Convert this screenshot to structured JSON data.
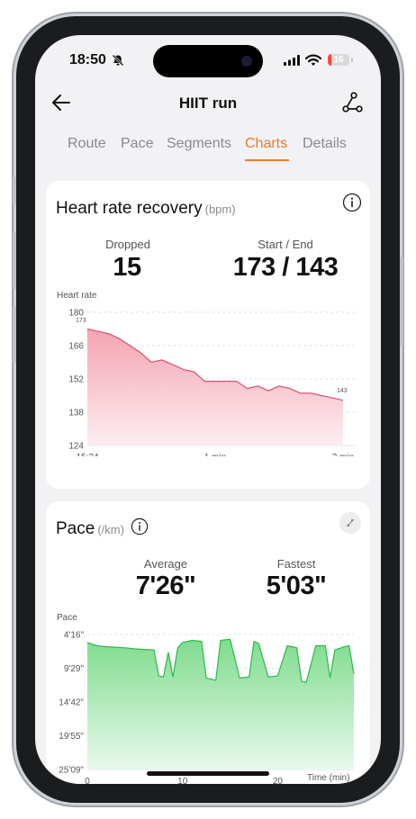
{
  "status_bar": {
    "time": "18:50",
    "battery_level": "16"
  },
  "nav": {
    "title": "HIIT run"
  },
  "tabs": [
    {
      "label": "Route",
      "active": false
    },
    {
      "label": "Pace",
      "active": false
    },
    {
      "label": "Segments",
      "active": false
    },
    {
      "label": "Charts",
      "active": true
    },
    {
      "label": "Details",
      "active": false
    }
  ],
  "heart_rate": {
    "title": "Heart rate recovery",
    "unit": "(bpm)",
    "dropped_label": "Dropped",
    "dropped_value": "15",
    "start_end_label": "Start / End",
    "start_end_value": "173 / 143",
    "y_axis_title": "Heart rate",
    "start_marker": "173",
    "end_marker": "143"
  },
  "pace": {
    "title": "Pace",
    "unit": "(/km)",
    "average_label": "Average",
    "average_value": "7'26\"",
    "fastest_label": "Fastest",
    "fastest_value": "5'03\"",
    "y_axis_title": "Pace",
    "x_axis_title": "Time (min)"
  },
  "colors": {
    "accent": "#f07a2a",
    "heart_rate_line": "#d9536b",
    "pace_line": "#2db84b"
  },
  "chart_data": [
    {
      "type": "area",
      "title": "Heart rate recovery",
      "ylabel": "Heart rate",
      "ylim": [
        124,
        180
      ],
      "y_ticks": [
        "180",
        "166",
        "152",
        "138",
        "124"
      ],
      "x_ticks": [
        "15:34",
        "1 min",
        "2 min"
      ],
      "xlim": [
        0,
        120
      ],
      "x": [
        0,
        5,
        10,
        15,
        20,
        25,
        30,
        35,
        40,
        45,
        50,
        55,
        60,
        65,
        70,
        75,
        80,
        85,
        90,
        95,
        100,
        105,
        110,
        115,
        120
      ],
      "y": [
        173,
        172,
        171,
        169,
        166,
        163,
        159,
        160,
        158,
        156,
        155,
        151,
        151,
        151,
        151,
        148,
        149,
        147,
        149,
        148,
        146,
        146,
        145,
        144,
        143
      ]
    },
    {
      "type": "area",
      "title": "Pace",
      "ylabel": "Pace",
      "xlabel": "Time (min)",
      "y_ticks": [
        "4'16\"",
        "9'29\"",
        "14'42\"",
        "19'55\"",
        "25'09\""
      ],
      "y_tick_seconds": [
        256,
        569,
        882,
        1195,
        1509
      ],
      "ylim_seconds": [
        256,
        1509
      ],
      "x_ticks": [
        "0",
        "10",
        "20"
      ],
      "xlim": [
        0,
        28
      ],
      "x": [
        0,
        1,
        2,
        3,
        4,
        5,
        6,
        7,
        7.5,
        8,
        8.5,
        9,
        9.5,
        10,
        11,
        12,
        12.5,
        13,
        13.5,
        14,
        15,
        16,
        17,
        17.5,
        18,
        19,
        20,
        21,
        22,
        22.5,
        23,
        24,
        25,
        25.5,
        26,
        27,
        27.5,
        28
      ],
      "y_seconds": [
        330,
        360,
        370,
        375,
        380,
        390,
        395,
        400,
        640,
        650,
        420,
        650,
        380,
        330,
        310,
        320,
        660,
        670,
        680,
        310,
        300,
        660,
        650,
        320,
        340,
        650,
        640,
        360,
        380,
        690,
        700,
        360,
        360,
        660,
        400,
        370,
        360,
        620
      ]
    }
  ]
}
